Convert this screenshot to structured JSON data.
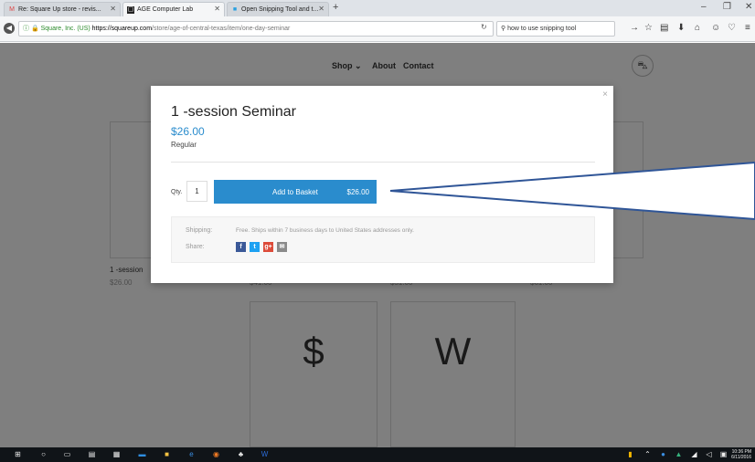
{
  "browser": {
    "tabs": [
      {
        "label": "Re: Square Up store - revis...",
        "icon": "gmail-icon",
        "active": false
      },
      {
        "label": "AGE Computer Lab",
        "icon": "square-logo-icon",
        "active": true
      },
      {
        "label": "Open Snipping Tool and t...",
        "icon": "windows-icon",
        "active": false
      }
    ],
    "url_org": "Square, Inc. (US)",
    "url_host": "https://squareup.com",
    "url_path": "/store/age-of-central-texas/item/one-day-seminar",
    "search_value": "how to use snipping tool"
  },
  "site": {
    "nav": [
      "Shop ⌄",
      "About",
      "Contact"
    ],
    "cart_count": "1"
  },
  "products": [
    {
      "name": "1 -session",
      "price": "$26.00"
    },
    {
      "price": "$41.00"
    },
    {
      "price": "$51.00"
    },
    {
      "price": "$61.00"
    },
    {
      "glyph": "$"
    },
    {
      "glyph": "W"
    }
  ],
  "modal": {
    "close": "×",
    "title": "1 -session Seminar",
    "price": "$26.00",
    "variant": "Regular",
    "qty_label": "Qty.",
    "qty_value": "1",
    "add_label": "Add to Basket",
    "add_amount": "$26.00",
    "shipping_label": "Shipping:",
    "shipping_text": "Free. Ships within 7 business days to United States addresses only.",
    "share_label": "Share:"
  },
  "colors": {
    "accent": "#2a8ccd",
    "facebook": "#3b5998",
    "twitter": "#1da1f2",
    "googleplus": "#dd4b39",
    "email": "#8a8a8a"
  },
  "taskbar": {
    "time": "10:36 PM",
    "date": "6/11/2016"
  }
}
